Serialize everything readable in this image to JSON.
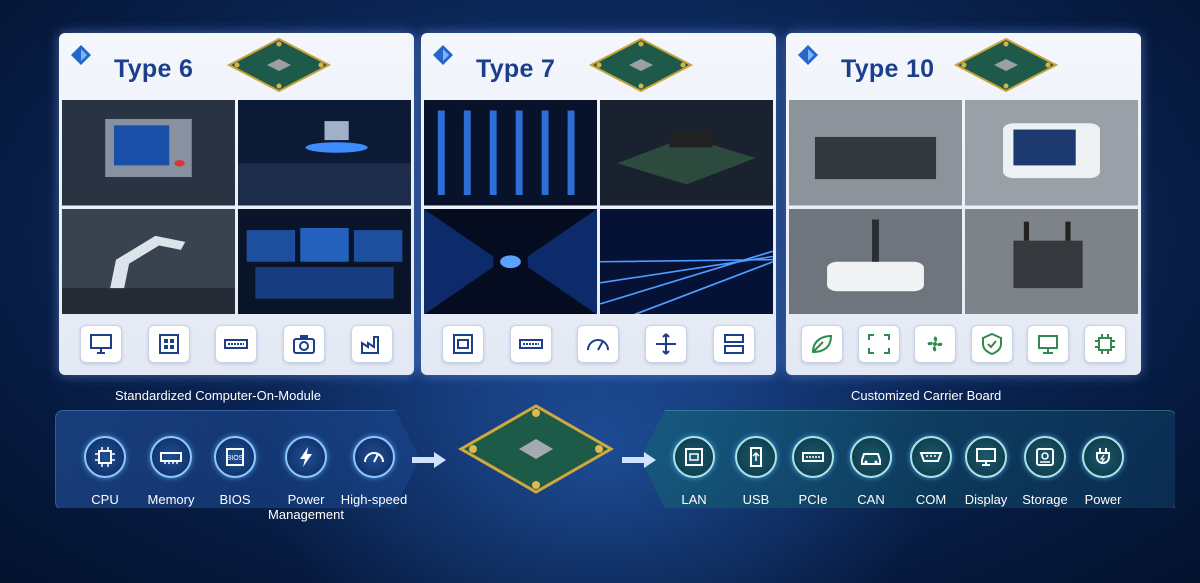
{
  "cards": [
    {
      "title": "Type 6",
      "icons": [
        "monitor-icon",
        "network-switch-icon",
        "pci-slot-icon",
        "camera-icon",
        "factory-icon"
      ]
    },
    {
      "title": "Type 7",
      "icons": [
        "ethernet-port-icon",
        "pci-slot-icon",
        "speed-gauge-icon",
        "move-arrows-icon",
        "server-icon"
      ]
    },
    {
      "title": "Type 10",
      "icons": [
        "leaf-icon",
        "expand-icon",
        "fan-icon",
        "shield-check-icon",
        "display-stand-icon",
        "chip-icon"
      ]
    }
  ],
  "captions": {
    "left": "Standardized Computer-On-Module",
    "right": "Customized Carrier Board"
  },
  "module_features": [
    {
      "label": "CPU",
      "icon": "cpu-icon"
    },
    {
      "label": "Memory",
      "icon": "memory-icon"
    },
    {
      "label": "BIOS",
      "icon": "bios-icon"
    },
    {
      "label": "Power Management",
      "icon": "lightning-icon"
    },
    {
      "label": "High-speed",
      "icon": "speedometer-icon"
    }
  ],
  "bios_chip_text": "BIOS",
  "carrier_features": [
    {
      "label": "LAN",
      "icon": "lan-icon"
    },
    {
      "label": "USB",
      "icon": "usb-icon"
    },
    {
      "label": "PCIe",
      "icon": "pcie-icon"
    },
    {
      "label": "CAN",
      "icon": "car-icon"
    },
    {
      "label": "COM",
      "icon": "serial-port-icon"
    },
    {
      "label": "Display",
      "icon": "display-icon"
    },
    {
      "label": "Storage",
      "icon": "storage-icon"
    },
    {
      "label": "Power",
      "icon": "power-plug-icon"
    }
  ],
  "colors": {
    "accent": "#1b3f8c",
    "glow": "#8fc7ff",
    "carrier": "#a8e6e6"
  }
}
